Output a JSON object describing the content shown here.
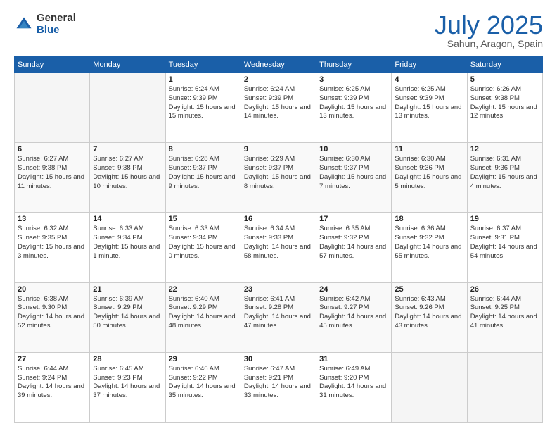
{
  "logo": {
    "general": "General",
    "blue": "Blue"
  },
  "header": {
    "month": "July 2025",
    "location": "Sahun, Aragon, Spain"
  },
  "weekdays": [
    "Sunday",
    "Monday",
    "Tuesday",
    "Wednesday",
    "Thursday",
    "Friday",
    "Saturday"
  ],
  "weeks": [
    [
      {
        "day": "",
        "info": ""
      },
      {
        "day": "",
        "info": ""
      },
      {
        "day": "1",
        "info": "Sunrise: 6:24 AM\nSunset: 9:39 PM\nDaylight: 15 hours and 15 minutes."
      },
      {
        "day": "2",
        "info": "Sunrise: 6:24 AM\nSunset: 9:39 PM\nDaylight: 15 hours and 14 minutes."
      },
      {
        "day": "3",
        "info": "Sunrise: 6:25 AM\nSunset: 9:39 PM\nDaylight: 15 hours and 13 minutes."
      },
      {
        "day": "4",
        "info": "Sunrise: 6:25 AM\nSunset: 9:39 PM\nDaylight: 15 hours and 13 minutes."
      },
      {
        "day": "5",
        "info": "Sunrise: 6:26 AM\nSunset: 9:38 PM\nDaylight: 15 hours and 12 minutes."
      }
    ],
    [
      {
        "day": "6",
        "info": "Sunrise: 6:27 AM\nSunset: 9:38 PM\nDaylight: 15 hours and 11 minutes."
      },
      {
        "day": "7",
        "info": "Sunrise: 6:27 AM\nSunset: 9:38 PM\nDaylight: 15 hours and 10 minutes."
      },
      {
        "day": "8",
        "info": "Sunrise: 6:28 AM\nSunset: 9:37 PM\nDaylight: 15 hours and 9 minutes."
      },
      {
        "day": "9",
        "info": "Sunrise: 6:29 AM\nSunset: 9:37 PM\nDaylight: 15 hours and 8 minutes."
      },
      {
        "day": "10",
        "info": "Sunrise: 6:30 AM\nSunset: 9:37 PM\nDaylight: 15 hours and 7 minutes."
      },
      {
        "day": "11",
        "info": "Sunrise: 6:30 AM\nSunset: 9:36 PM\nDaylight: 15 hours and 5 minutes."
      },
      {
        "day": "12",
        "info": "Sunrise: 6:31 AM\nSunset: 9:36 PM\nDaylight: 15 hours and 4 minutes."
      }
    ],
    [
      {
        "day": "13",
        "info": "Sunrise: 6:32 AM\nSunset: 9:35 PM\nDaylight: 15 hours and 3 minutes."
      },
      {
        "day": "14",
        "info": "Sunrise: 6:33 AM\nSunset: 9:34 PM\nDaylight: 15 hours and 1 minute."
      },
      {
        "day": "15",
        "info": "Sunrise: 6:33 AM\nSunset: 9:34 PM\nDaylight: 15 hours and 0 minutes."
      },
      {
        "day": "16",
        "info": "Sunrise: 6:34 AM\nSunset: 9:33 PM\nDaylight: 14 hours and 58 minutes."
      },
      {
        "day": "17",
        "info": "Sunrise: 6:35 AM\nSunset: 9:32 PM\nDaylight: 14 hours and 57 minutes."
      },
      {
        "day": "18",
        "info": "Sunrise: 6:36 AM\nSunset: 9:32 PM\nDaylight: 14 hours and 55 minutes."
      },
      {
        "day": "19",
        "info": "Sunrise: 6:37 AM\nSunset: 9:31 PM\nDaylight: 14 hours and 54 minutes."
      }
    ],
    [
      {
        "day": "20",
        "info": "Sunrise: 6:38 AM\nSunset: 9:30 PM\nDaylight: 14 hours and 52 minutes."
      },
      {
        "day": "21",
        "info": "Sunrise: 6:39 AM\nSunset: 9:29 PM\nDaylight: 14 hours and 50 minutes."
      },
      {
        "day": "22",
        "info": "Sunrise: 6:40 AM\nSunset: 9:29 PM\nDaylight: 14 hours and 48 minutes."
      },
      {
        "day": "23",
        "info": "Sunrise: 6:41 AM\nSunset: 9:28 PM\nDaylight: 14 hours and 47 minutes."
      },
      {
        "day": "24",
        "info": "Sunrise: 6:42 AM\nSunset: 9:27 PM\nDaylight: 14 hours and 45 minutes."
      },
      {
        "day": "25",
        "info": "Sunrise: 6:43 AM\nSunset: 9:26 PM\nDaylight: 14 hours and 43 minutes."
      },
      {
        "day": "26",
        "info": "Sunrise: 6:44 AM\nSunset: 9:25 PM\nDaylight: 14 hours and 41 minutes."
      }
    ],
    [
      {
        "day": "27",
        "info": "Sunrise: 6:44 AM\nSunset: 9:24 PM\nDaylight: 14 hours and 39 minutes."
      },
      {
        "day": "28",
        "info": "Sunrise: 6:45 AM\nSunset: 9:23 PM\nDaylight: 14 hours and 37 minutes."
      },
      {
        "day": "29",
        "info": "Sunrise: 6:46 AM\nSunset: 9:22 PM\nDaylight: 14 hours and 35 minutes."
      },
      {
        "day": "30",
        "info": "Sunrise: 6:47 AM\nSunset: 9:21 PM\nDaylight: 14 hours and 33 minutes."
      },
      {
        "day": "31",
        "info": "Sunrise: 6:49 AM\nSunset: 9:20 PM\nDaylight: 14 hours and 31 minutes."
      },
      {
        "day": "",
        "info": ""
      },
      {
        "day": "",
        "info": ""
      }
    ]
  ]
}
